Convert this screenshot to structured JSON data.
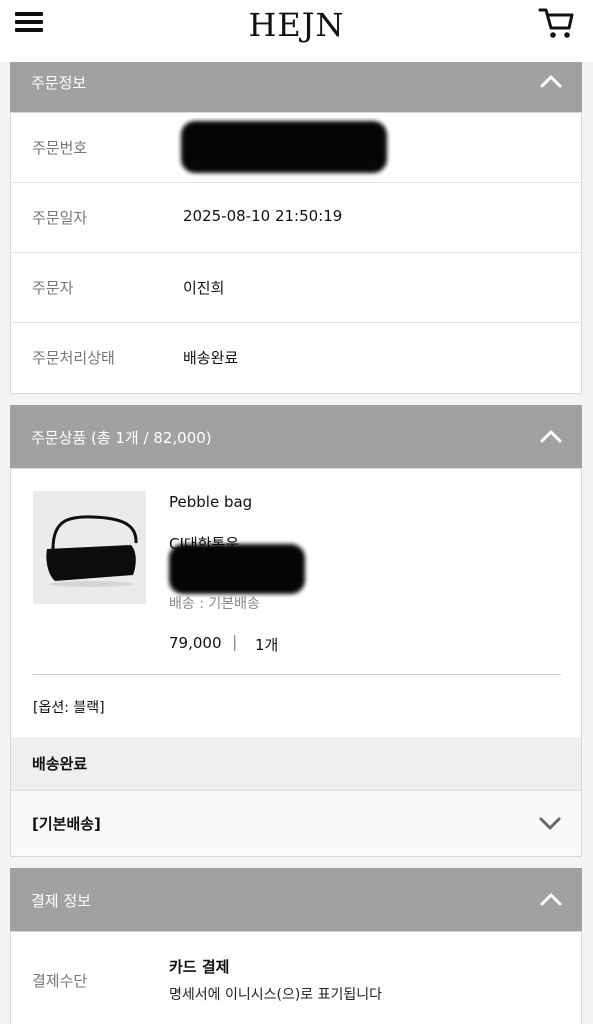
{
  "header": {
    "logo": "HEJN",
    "menu_icon": "hamburger-icon",
    "cart_icon": "cart-icon"
  },
  "order_info": {
    "title": "주문정보",
    "rows": [
      {
        "label": "주문번호",
        "value": "",
        "redacted": true
      },
      {
        "label": "주문일자",
        "value": "2025-08-10 21:50:19"
      },
      {
        "label": "주문자",
        "value": "이진희"
      },
      {
        "label": "주문처리상태",
        "value": "배송완료"
      }
    ]
  },
  "order_items": {
    "title": "주문상품 (총 1개 / 82,000)",
    "product": {
      "name": "Pebble bag",
      "courier": "CJ대한통운",
      "shipping": "배송 : 기본배송",
      "price": "79,000",
      "separator": "|",
      "qty": "1개",
      "option": "[옵션: 블랙]"
    },
    "status": "배송완료",
    "delivery_label": "[기본배송]"
  },
  "payment": {
    "title": "결제 정보",
    "label": "결제수단",
    "method": "카드 결제",
    "note": "명세서에 이니시스(으)로 표기됩니다"
  },
  "colors": {
    "section_header": "#a1a1a1",
    "background": "#f4f4f4"
  }
}
